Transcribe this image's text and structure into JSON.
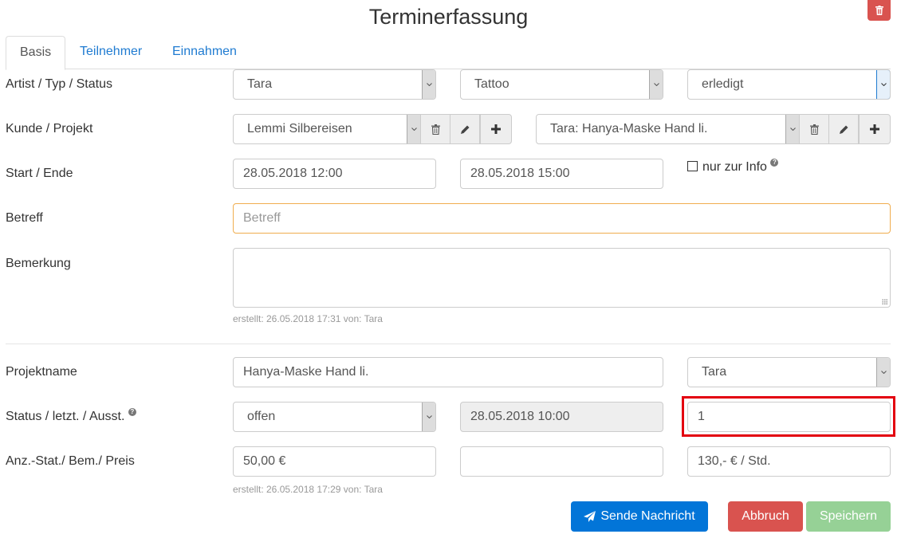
{
  "page": {
    "title": "Terminerfassung"
  },
  "tabs": [
    {
      "label": "Basis",
      "active": true
    },
    {
      "label": "Teilnehmer",
      "active": false
    },
    {
      "label": "Einnahmen",
      "active": false
    }
  ],
  "basis": {
    "artist_label": "Artist / Typ / Status",
    "artist_value": "Tara",
    "typ_value": "Tattoo",
    "status_value": "erledigt",
    "kunde_label": "Kunde / Projekt",
    "kunde_value": "Lemmi Silbereisen",
    "projekt_value": "Tara: Hanya-Maske Hand li.",
    "start_label": "Start / Ende",
    "start_value": "28.05.2018 12:00",
    "ende_value": "28.05.2018 15:00",
    "info_checkbox_label": "nur zur Info",
    "info_checked": false,
    "betreff_label": "Betreff",
    "betreff_value": "",
    "betreff_placeholder": "Betreff",
    "bemerkung_label": "Bemerkung",
    "bemerkung_value": "",
    "created_meta": "erstellt: 26.05.2018 17:31 von: Tara"
  },
  "projekt": {
    "name_label": "Projektname",
    "name_value": "Hanya-Maske Hand li.",
    "artist_value": "Tara",
    "status_label": "Status / letzt. / Ausst.",
    "status_value": "offen",
    "letzt_value": "28.05.2018 10:00",
    "ausst_value": "1",
    "anz_label": "Anz.-Stat./ Bem./ Preis",
    "anz_value": "50,00 €",
    "bem_value": "",
    "preis_value": "130,- € / Std.",
    "created_meta": "erstellt: 26.05.2018 17:29 von: Tara"
  },
  "actions": {
    "send_label": "Sende Nachricht",
    "cancel_label": "Abbruch",
    "save_label": "Speichern"
  },
  "icons": {
    "delete": "trash-icon",
    "edit": "pencil-icon",
    "add": "plus-icon",
    "send": "paper-plane-icon",
    "help": "question-circle-icon",
    "caret": "chevron-down-icon"
  },
  "colors": {
    "primary": "#0275d8",
    "danger": "#d9534f",
    "success_disabled": "#96d196",
    "link": "#1f7bd1",
    "warning_border": "#f0ad4e",
    "highlight": "#e3000f"
  }
}
